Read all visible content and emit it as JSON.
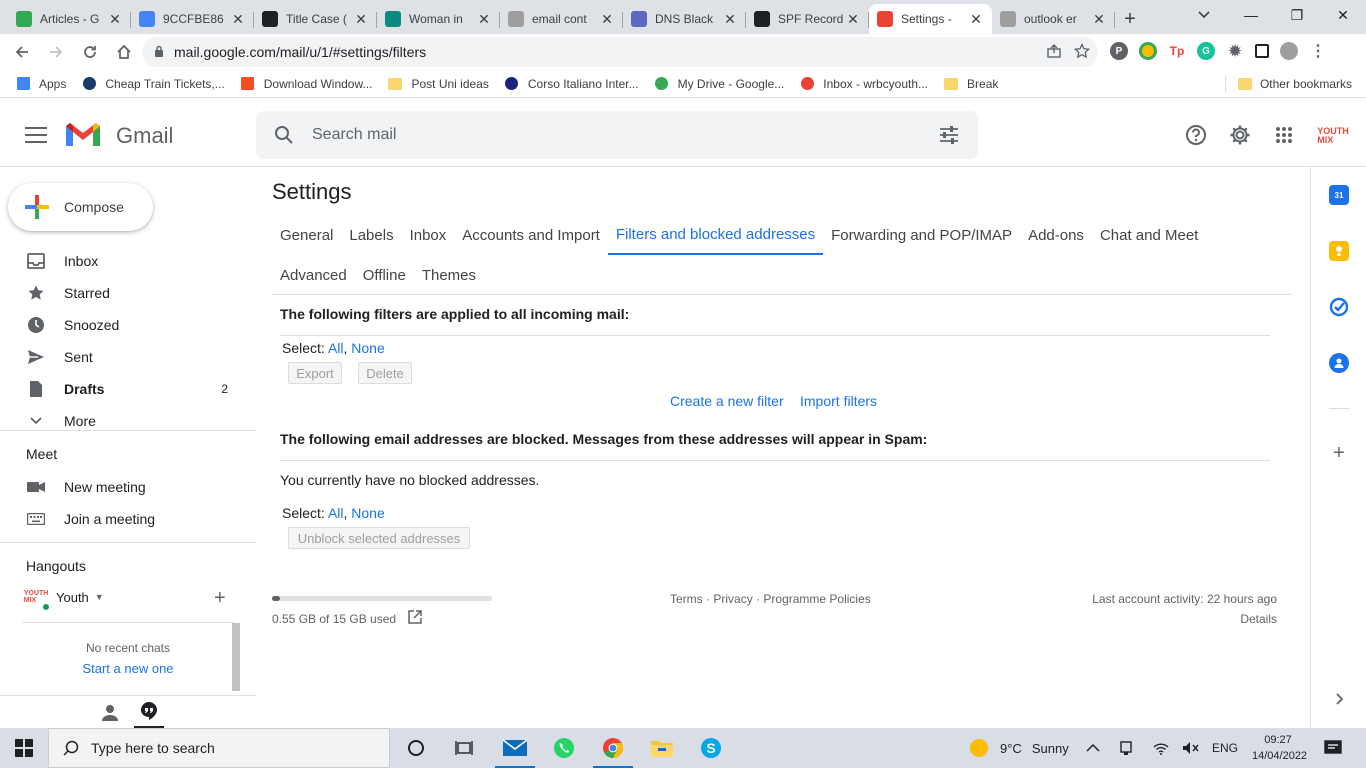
{
  "browser": {
    "tabs": [
      {
        "title": "Articles - G",
        "icon_color": "#34a853",
        "icon": "drive-icon"
      },
      {
        "title": "9CCFBE86",
        "icon_color": "#4285f4",
        "icon": "docs-icon"
      },
      {
        "title": "Title Case (",
        "icon_color": "#202124",
        "icon": "cc-icon"
      },
      {
        "title": "Woman in",
        "icon_color": "#0b8a7f",
        "icon": "d-icon"
      },
      {
        "title": "email cont",
        "icon_color": "#9e9e9e",
        "icon": "globe-icon"
      },
      {
        "title": "DNS Black",
        "icon_color": "#5c6bc0",
        "icon": "dns-icon"
      },
      {
        "title": "SPF Record",
        "icon_color": "#202124",
        "icon": "spf-icon"
      },
      {
        "title": "Settings - ",
        "icon_color": "#ea4335",
        "icon": "gmail-icon"
      },
      {
        "title": "outlook er",
        "icon_color": "#9e9e9e",
        "icon": "globe-icon"
      }
    ],
    "url": "mail.google.com/mail/u/1/#settings/filters",
    "bookmarks": [
      {
        "label": "Apps",
        "icon": "apps-grid-icon"
      },
      {
        "label": "Cheap Train Tickets,...",
        "icon": "train-icon"
      },
      {
        "label": "Download Window...",
        "icon": "windows-icon"
      },
      {
        "label": "Post Uni ideas",
        "icon": "folder-icon"
      },
      {
        "label": "Corso Italiano Inter...",
        "icon": "globe-icon"
      },
      {
        "label": "My Drive - Google...",
        "icon": "drive-icon"
      },
      {
        "label": "Inbox - wrbcyouth...",
        "icon": "gmail-icon"
      },
      {
        "label": "Break",
        "icon": "folder-icon"
      }
    ],
    "other_bookmarks": "Other bookmarks"
  },
  "gmail": {
    "brand": "Gmail",
    "search_placeholder": "Search mail",
    "compose": "Compose",
    "nav": [
      {
        "label": "Inbox",
        "icon": "inbox-icon",
        "count": ""
      },
      {
        "label": "Starred",
        "icon": "star-icon",
        "count": ""
      },
      {
        "label": "Snoozed",
        "icon": "clock-icon",
        "count": ""
      },
      {
        "label": "Sent",
        "icon": "send-icon",
        "count": ""
      },
      {
        "label": "Drafts",
        "icon": "draft-icon",
        "count": "2"
      },
      {
        "label": "More",
        "icon": "chevron-down-icon",
        "count": ""
      }
    ],
    "meet": {
      "title": "Meet",
      "new_meeting": "New meeting",
      "join_meeting": "Join a meeting"
    },
    "hangouts": {
      "title": "Hangouts",
      "user": "Youth",
      "no_recent": "No recent chats",
      "start_new": "Start a new one"
    },
    "avatar_text": "YOUTH MIX"
  },
  "settings": {
    "title": "Settings",
    "tabs_row1": [
      "General",
      "Labels",
      "Inbox",
      "Accounts and Import",
      "Filters and blocked addresses",
      "Forwarding and POP/IMAP",
      "Add-ons",
      "Chat and Meet"
    ],
    "tabs_row2": [
      "Advanced",
      "Offline",
      "Themes"
    ],
    "active_tab": "Filters and blocked addresses",
    "filters_heading": "The following filters are applied to all incoming mail:",
    "select_label": "Select:",
    "select_all": "All",
    "select_none": "None",
    "export": "Export",
    "delete": "Delete",
    "create_filter": "Create a new filter",
    "import_filters": "Import filters",
    "blocked_heading": "The following email addresses are blocked. Messages from these addresses will appear in Spam:",
    "no_blocked": "You currently have no blocked addresses.",
    "unblock": "Unblock selected addresses"
  },
  "footer": {
    "storage": "0.55 GB of 15 GB used",
    "storage_fraction": 0.037,
    "terms": "Terms",
    "privacy": "Privacy",
    "policies": "Programme Policies",
    "sep": "·",
    "last_activity": "Last account activity: 22 hours ago",
    "details": "Details"
  },
  "taskbar": {
    "search_placeholder": "Type here to search",
    "weather_temp": "9°C",
    "weather_text": "Sunny",
    "lang": "ENG",
    "time": "09:27",
    "date": "14/04/2022"
  },
  "colors": {
    "accent": "#1a73e8",
    "gmail_red": "#ea4335",
    "text": "#202124"
  }
}
